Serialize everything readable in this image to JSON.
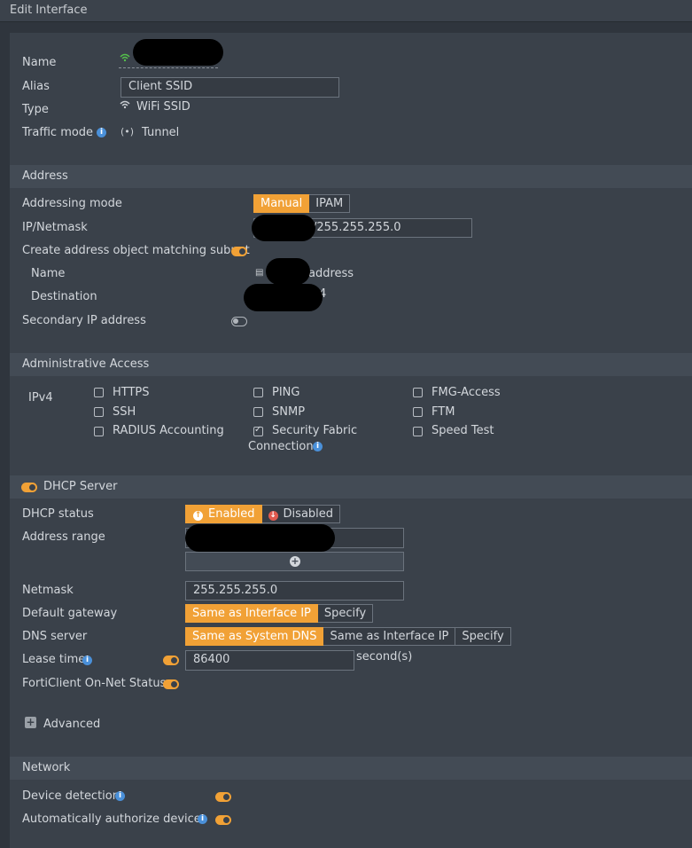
{
  "window": {
    "title": "Edit Interface"
  },
  "general": {
    "name_label": "Name",
    "alias_label": "Alias",
    "alias_value": "Client SSID",
    "type_label": "Type",
    "type_value": "WiFi SSID",
    "traffic_label": "Traffic mode",
    "traffic_value": "Tunnel"
  },
  "address": {
    "header": "Address",
    "mode_label": "Addressing mode",
    "mode_options": [
      "Manual",
      "IPAM"
    ],
    "mode_selected": "Manual",
    "ip_label": "IP/Netmask",
    "ip_value": "/255.255.255.0",
    "create_obj_label": "Create address object matching subnet",
    "create_obj_enabled": true,
    "obj_name_label": "Name",
    "obj_name_value": "address",
    "obj_dest_label": "Destination",
    "obj_dest_value": "4",
    "secondary_label": "Secondary IP address",
    "secondary_enabled": false
  },
  "admin_access": {
    "header": "Administrative Access",
    "ipv4_label": "IPv4",
    "options": [
      {
        "label": "HTTPS",
        "checked": false
      },
      {
        "label": "PING",
        "checked": false
      },
      {
        "label": "FMG-Access",
        "checked": false
      },
      {
        "label": "SSH",
        "checked": false
      },
      {
        "label": "SNMP",
        "checked": false
      },
      {
        "label": "FTM",
        "checked": false
      },
      {
        "label": "RADIUS Accounting",
        "checked": false
      },
      {
        "label": "Security Fabric",
        "checked": true
      },
      {
        "label": "Speed Test",
        "checked": false
      }
    ],
    "fabric_line2": "Connection"
  },
  "dhcp": {
    "header": "DHCP Server",
    "enabled": true,
    "status_label": "DHCP status",
    "status_options": [
      "Enabled",
      "Disabled"
    ],
    "status_selected": "Enabled",
    "range_label": "Address range",
    "netmask_label": "Netmask",
    "netmask_value": "255.255.255.0",
    "gateway_label": "Default gateway",
    "gateway_options": [
      "Same as Interface IP",
      "Specify"
    ],
    "gateway_selected": "Same as Interface IP",
    "dns_label": "DNS server",
    "dns_options": [
      "Same as System DNS",
      "Same as Interface IP",
      "Specify"
    ],
    "dns_selected": "Same as System DNS",
    "lease_label": "Lease time",
    "lease_enabled": true,
    "lease_value": "86400",
    "lease_unit": "second(s)",
    "forticlient_label": "FortiClient On-Net Status",
    "forticlient_enabled": true,
    "advanced_label": "Advanced"
  },
  "network": {
    "header": "Network",
    "device_detection_label": "Device detection",
    "device_detection_enabled": true,
    "auto_auth_label": "Automatically authorize devices",
    "auto_auth_enabled": true
  },
  "colors": {
    "accent": "#f1a136",
    "background": "#2f353d",
    "panel": "#3a414a",
    "section": "#434b55",
    "info": "#4a90d9",
    "disabled_red": "#e05a4f"
  }
}
